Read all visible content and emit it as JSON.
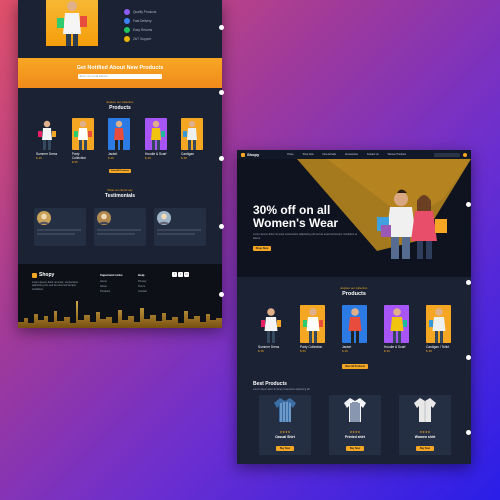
{
  "mock1": {
    "features": [
      "Quality Products",
      "Fast Delivery",
      "Easy Returns",
      "24/7 Support"
    ],
    "feature_colors": [
      "#8b5cf6",
      "#3b82f6",
      "#22c55e",
      "#eab308"
    ],
    "newsletter_title": "Get Notified About New Products",
    "newsletter_placeholder": "Enter your email address",
    "products_section_kicker": "Explore our collection",
    "products_section_title": "Products",
    "products": [
      {
        "name": "Summer Dress",
        "price": "$ 45",
        "bg": "#1a2233"
      },
      {
        "name": "Party Collection",
        "price": "$ 56",
        "bg": "#f5a623"
      },
      {
        "name": "Jacket",
        "price": "$ 49",
        "bg": "#2c7be5"
      },
      {
        "name": "Hoodie & Scarf",
        "price": "$ 40",
        "bg": "#a855f7"
      },
      {
        "name": "Cardigan",
        "price": "$ 38",
        "bg": "#f5a623"
      }
    ],
    "products_button": "View All Products",
    "testimonials_kicker": "What our clients say",
    "testimonials_title": "Testimonials",
    "footer_brand": "Shopy",
    "footer_about": "Lorem ipsum dolor sit amet, consectetur adipiscing elit, sed do eiusmod tempor incididunt.",
    "footer_col2_title": "Important Links",
    "footer_col2_items": [
      "Home",
      "About",
      "Products"
    ],
    "footer_col3_title": "Help",
    "footer_col3_items": [
      "Privacy",
      "Terms",
      "Contact"
    ],
    "footer_social": [
      "f",
      "t",
      "in"
    ]
  },
  "mock2": {
    "brand": "Shopy",
    "nav": [
      "Home",
      "Shop Now",
      "New Arrivals",
      "Accessories",
      "Contact Us",
      "Women Products"
    ],
    "hero_line1": "30% off on all",
    "hero_line2": "Women's Wear",
    "hero_text": "Lorem ipsum dolor sit amet consectetur adipiscing elit sed do eiusmod tempor incididunt ut labore",
    "hero_button": "Shop Now",
    "products_kicker": "Explore our collection",
    "products_title": "Products",
    "products": [
      {
        "name": "Summer Dress",
        "price": "$ 45",
        "bg": "#1a2233"
      },
      {
        "name": "Party Collection",
        "price": "$ 56",
        "bg": "#f5a623"
      },
      {
        "name": "Jacket",
        "price": "$ 49",
        "bg": "#2c7be5"
      },
      {
        "name": "Hoodie & Scarf",
        "price": "$ 40",
        "bg": "#a855f7"
      },
      {
        "name": "Cardigan / Tshirt",
        "price": "$ 38",
        "bg": "#f5a623"
      }
    ],
    "products_button": "View All Products",
    "best_title": "Best Products",
    "best_subtitle": "Lorem ipsum dolor sit amet consectetur adipiscing elit",
    "best": [
      {
        "name": "Casual Shirt",
        "rating": "★★★★",
        "button": "Buy Now",
        "stripe": "#3b6ea5"
      },
      {
        "name": "Printed shirt",
        "rating": "★★★★",
        "button": "Buy Now",
        "stripe": "#1f3a66"
      },
      {
        "name": "Women shirt",
        "rating": "★★★★",
        "button": "Buy Now",
        "stripe": "#e8e8e8"
      }
    ]
  },
  "colors": {
    "accent": "#f5a623",
    "dark": "#1a2233",
    "darker": "#111827"
  }
}
